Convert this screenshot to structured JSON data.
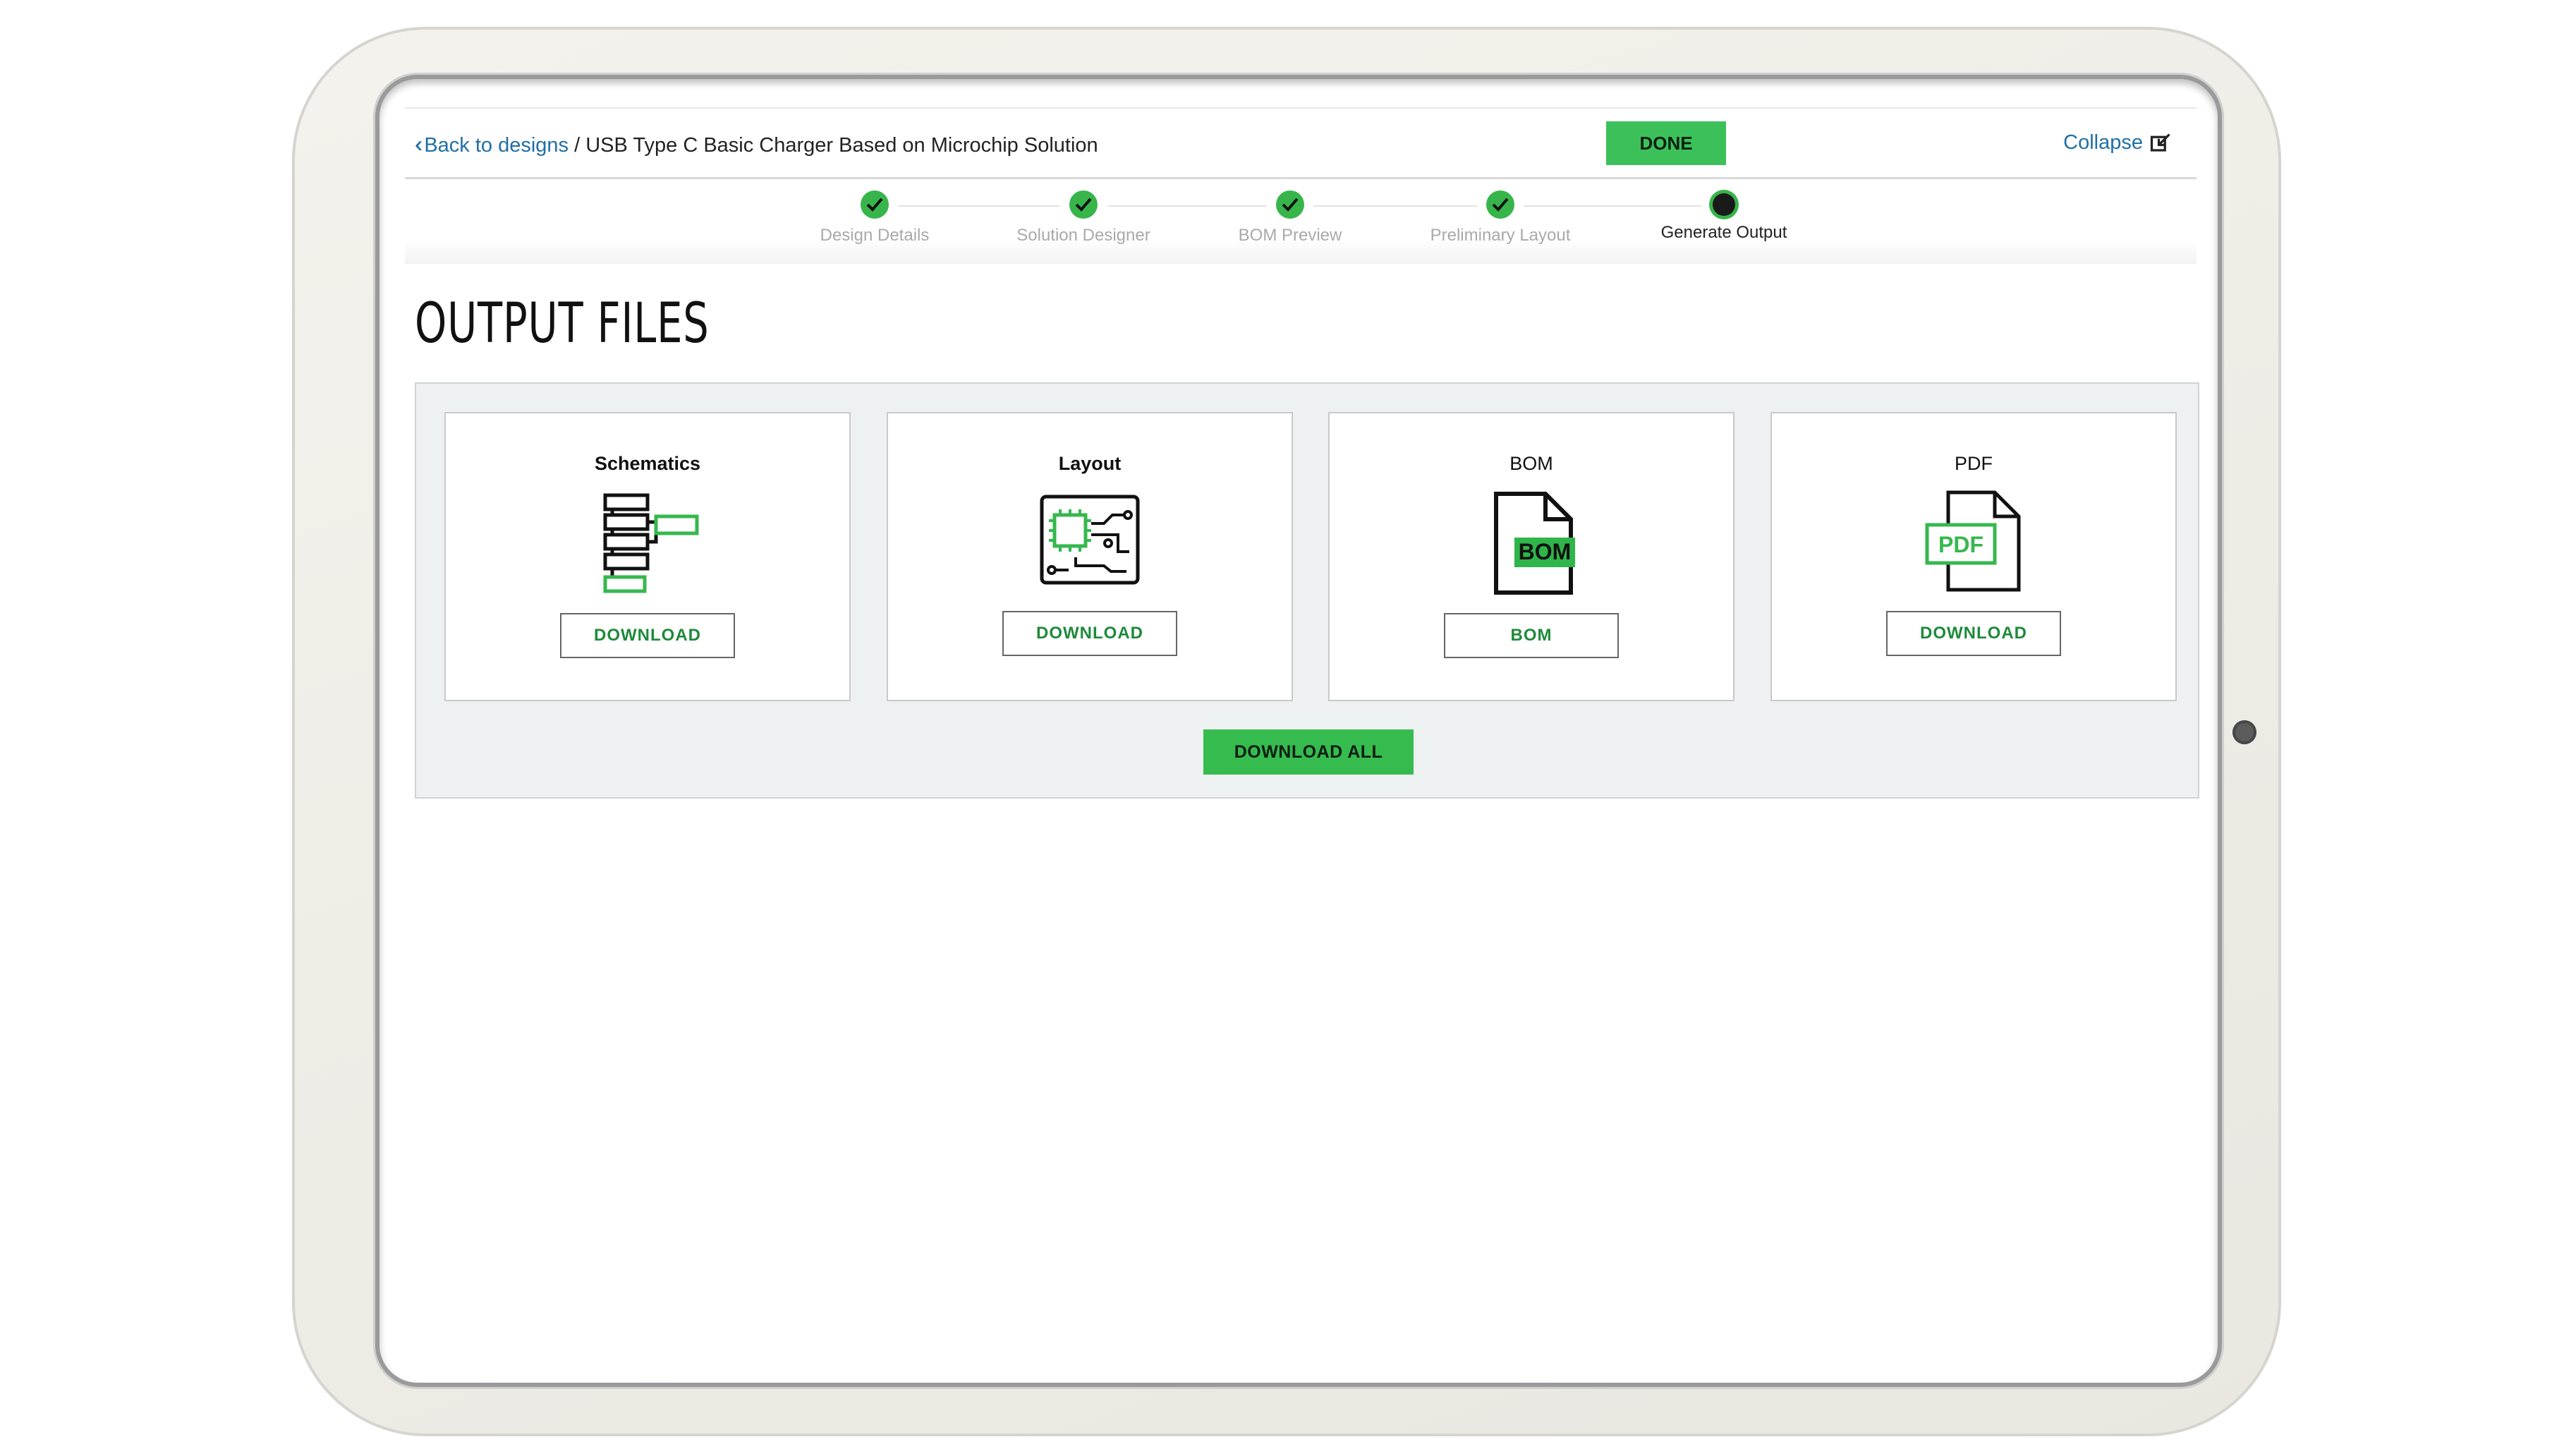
{
  "header": {
    "back_label": "Back to designs",
    "separator": "/",
    "design_name": "USB Type C Basic Charger Based on Microchip Solution",
    "done_label": "DONE",
    "collapse_label": "Collapse"
  },
  "steps": [
    {
      "label": "Design Details",
      "state": "complete"
    },
    {
      "label": "Solution Designer",
      "state": "complete"
    },
    {
      "label": "BOM Preview",
      "state": "complete"
    },
    {
      "label": "Preliminary Layout",
      "state": "complete"
    },
    {
      "label": "Generate Output",
      "state": "current"
    }
  ],
  "page_title": "OUTPUT FILES",
  "cards": [
    {
      "title": "Schematics",
      "icon": "schematic-icon",
      "button": "DOWNLOAD"
    },
    {
      "title": "Layout",
      "icon": "pcb-layout-icon",
      "button": "DOWNLOAD"
    },
    {
      "title": "BOM",
      "icon": "bom-file-icon",
      "icon_text": "BOM",
      "button": "BOM"
    },
    {
      "title": "PDF",
      "icon": "pdf-file-icon",
      "icon_text": "PDF",
      "button": "DOWNLOAD"
    }
  ],
  "download_all_label": "DOWNLOAD ALL",
  "colors": {
    "accent_green": "#3cc15a",
    "link_blue": "#1f6fa6",
    "panel_bg": "#eef1f2"
  }
}
